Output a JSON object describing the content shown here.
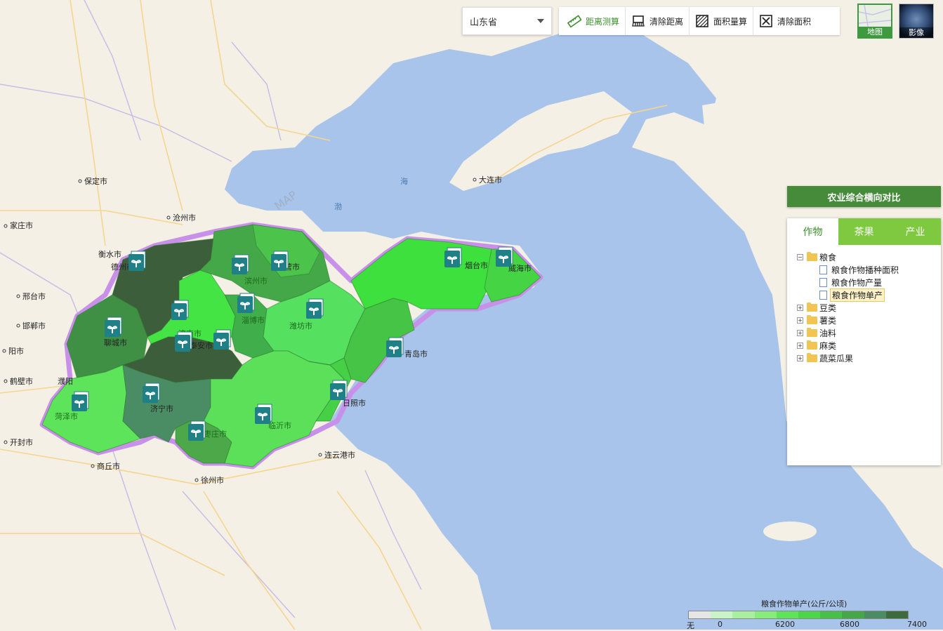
{
  "toolbar": {
    "province": "山东省",
    "distance_measure": "距离测算",
    "clear_distance": "清除距离",
    "area_measure": "面积量算",
    "clear_area": "清除面积"
  },
  "layers": {
    "map": "地图",
    "imagery": "影像"
  },
  "panel": {
    "title": "农业综合横向对比",
    "tabs": [
      "作物",
      "茶果",
      "产业"
    ],
    "tree": {
      "root": "粮食",
      "children": [
        "粮食作物播种面积",
        "粮食作物产量",
        "粮食作物单产"
      ],
      "others": [
        "豆类",
        "薯类",
        "油料",
        "麻类",
        "蔬菜瓜果"
      ]
    }
  },
  "legend": {
    "title": "粮食作物单产(公斤/公顷)",
    "ticks": [
      "无",
      "0",
      "6200",
      "6800",
      "7400"
    ],
    "colors": [
      "#e6e6e6",
      "#c8f5c8",
      "#a8f0a0",
      "#86ec7c",
      "#5ee45a",
      "#4cd64a",
      "#46c048",
      "#44a848",
      "#4a8c64",
      "#3c6b3c"
    ]
  },
  "map": {
    "sea_labels": [
      "海",
      "渤"
    ],
    "watermark": "MAP",
    "cities": [
      "保定市",
      "沧州市",
      "家庄市",
      "衡水市",
      "德州市",
      "邢台市",
      "邯郸市",
      "阳市",
      "鹤壁市",
      "濮阳",
      "开封市",
      "商丘市",
      "徐州市",
      "连云港市",
      "大连市",
      "烟台市",
      "威海市",
      "东营市",
      "滨州市",
      "淄博市",
      "潍坊市",
      "聊城市",
      "济南市",
      "泰安市",
      "青岛市",
      "日照市",
      "菏泽市",
      "济宁市",
      "枣庄市",
      "临沂市"
    ]
  }
}
